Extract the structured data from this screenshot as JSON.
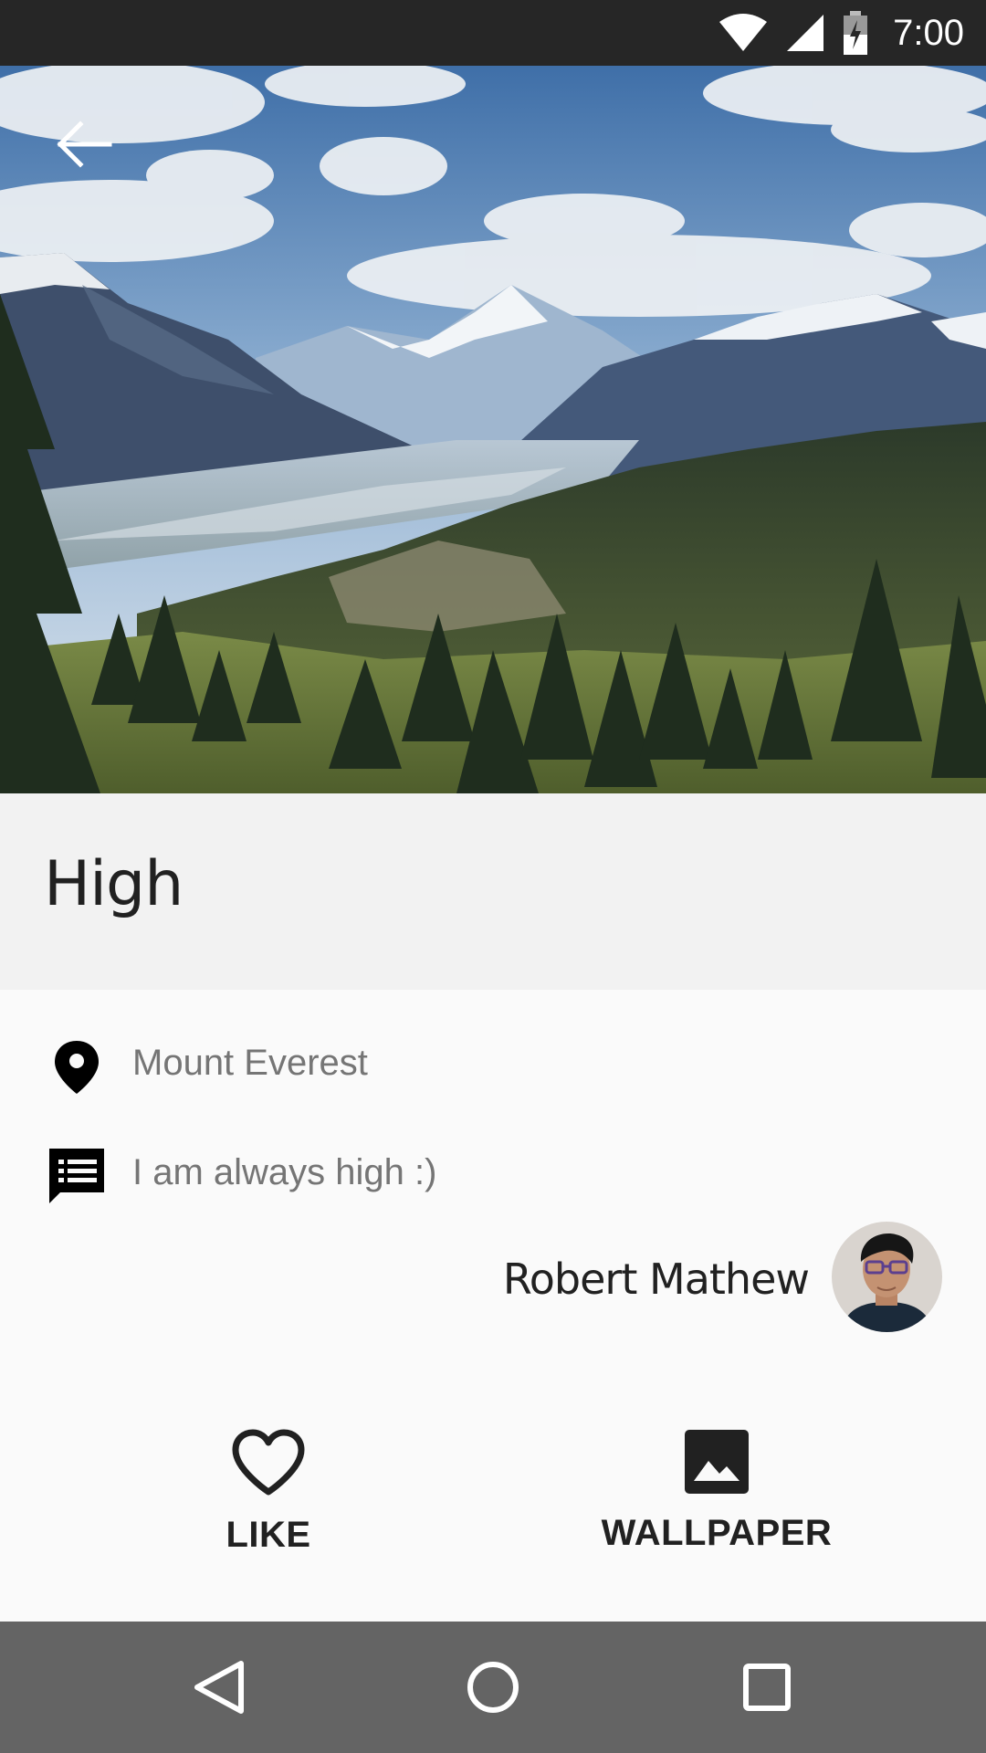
{
  "status_bar": {
    "time": "7:00",
    "icons": [
      "wifi-icon",
      "signal-icon",
      "battery-charging-icon"
    ]
  },
  "hero": {
    "image": "mountain-valley-landscape-photo"
  },
  "header": {
    "back_icon": "arrow-back-icon"
  },
  "post": {
    "title": "High",
    "location": "Mount Everest",
    "description": "I am always high :)",
    "author": "Robert Mathew"
  },
  "actions": {
    "like_label": "LIKE",
    "wallpaper_label": "WALLPAPER"
  },
  "nav_bar": {
    "icons": [
      "back-triangle-icon",
      "home-circle-icon",
      "recents-square-icon"
    ]
  },
  "colors": {
    "status_bar": "#262626",
    "nav_bar": "#646464",
    "title_bg": "#f2f2f2",
    "body_bg": "#fafafa"
  }
}
